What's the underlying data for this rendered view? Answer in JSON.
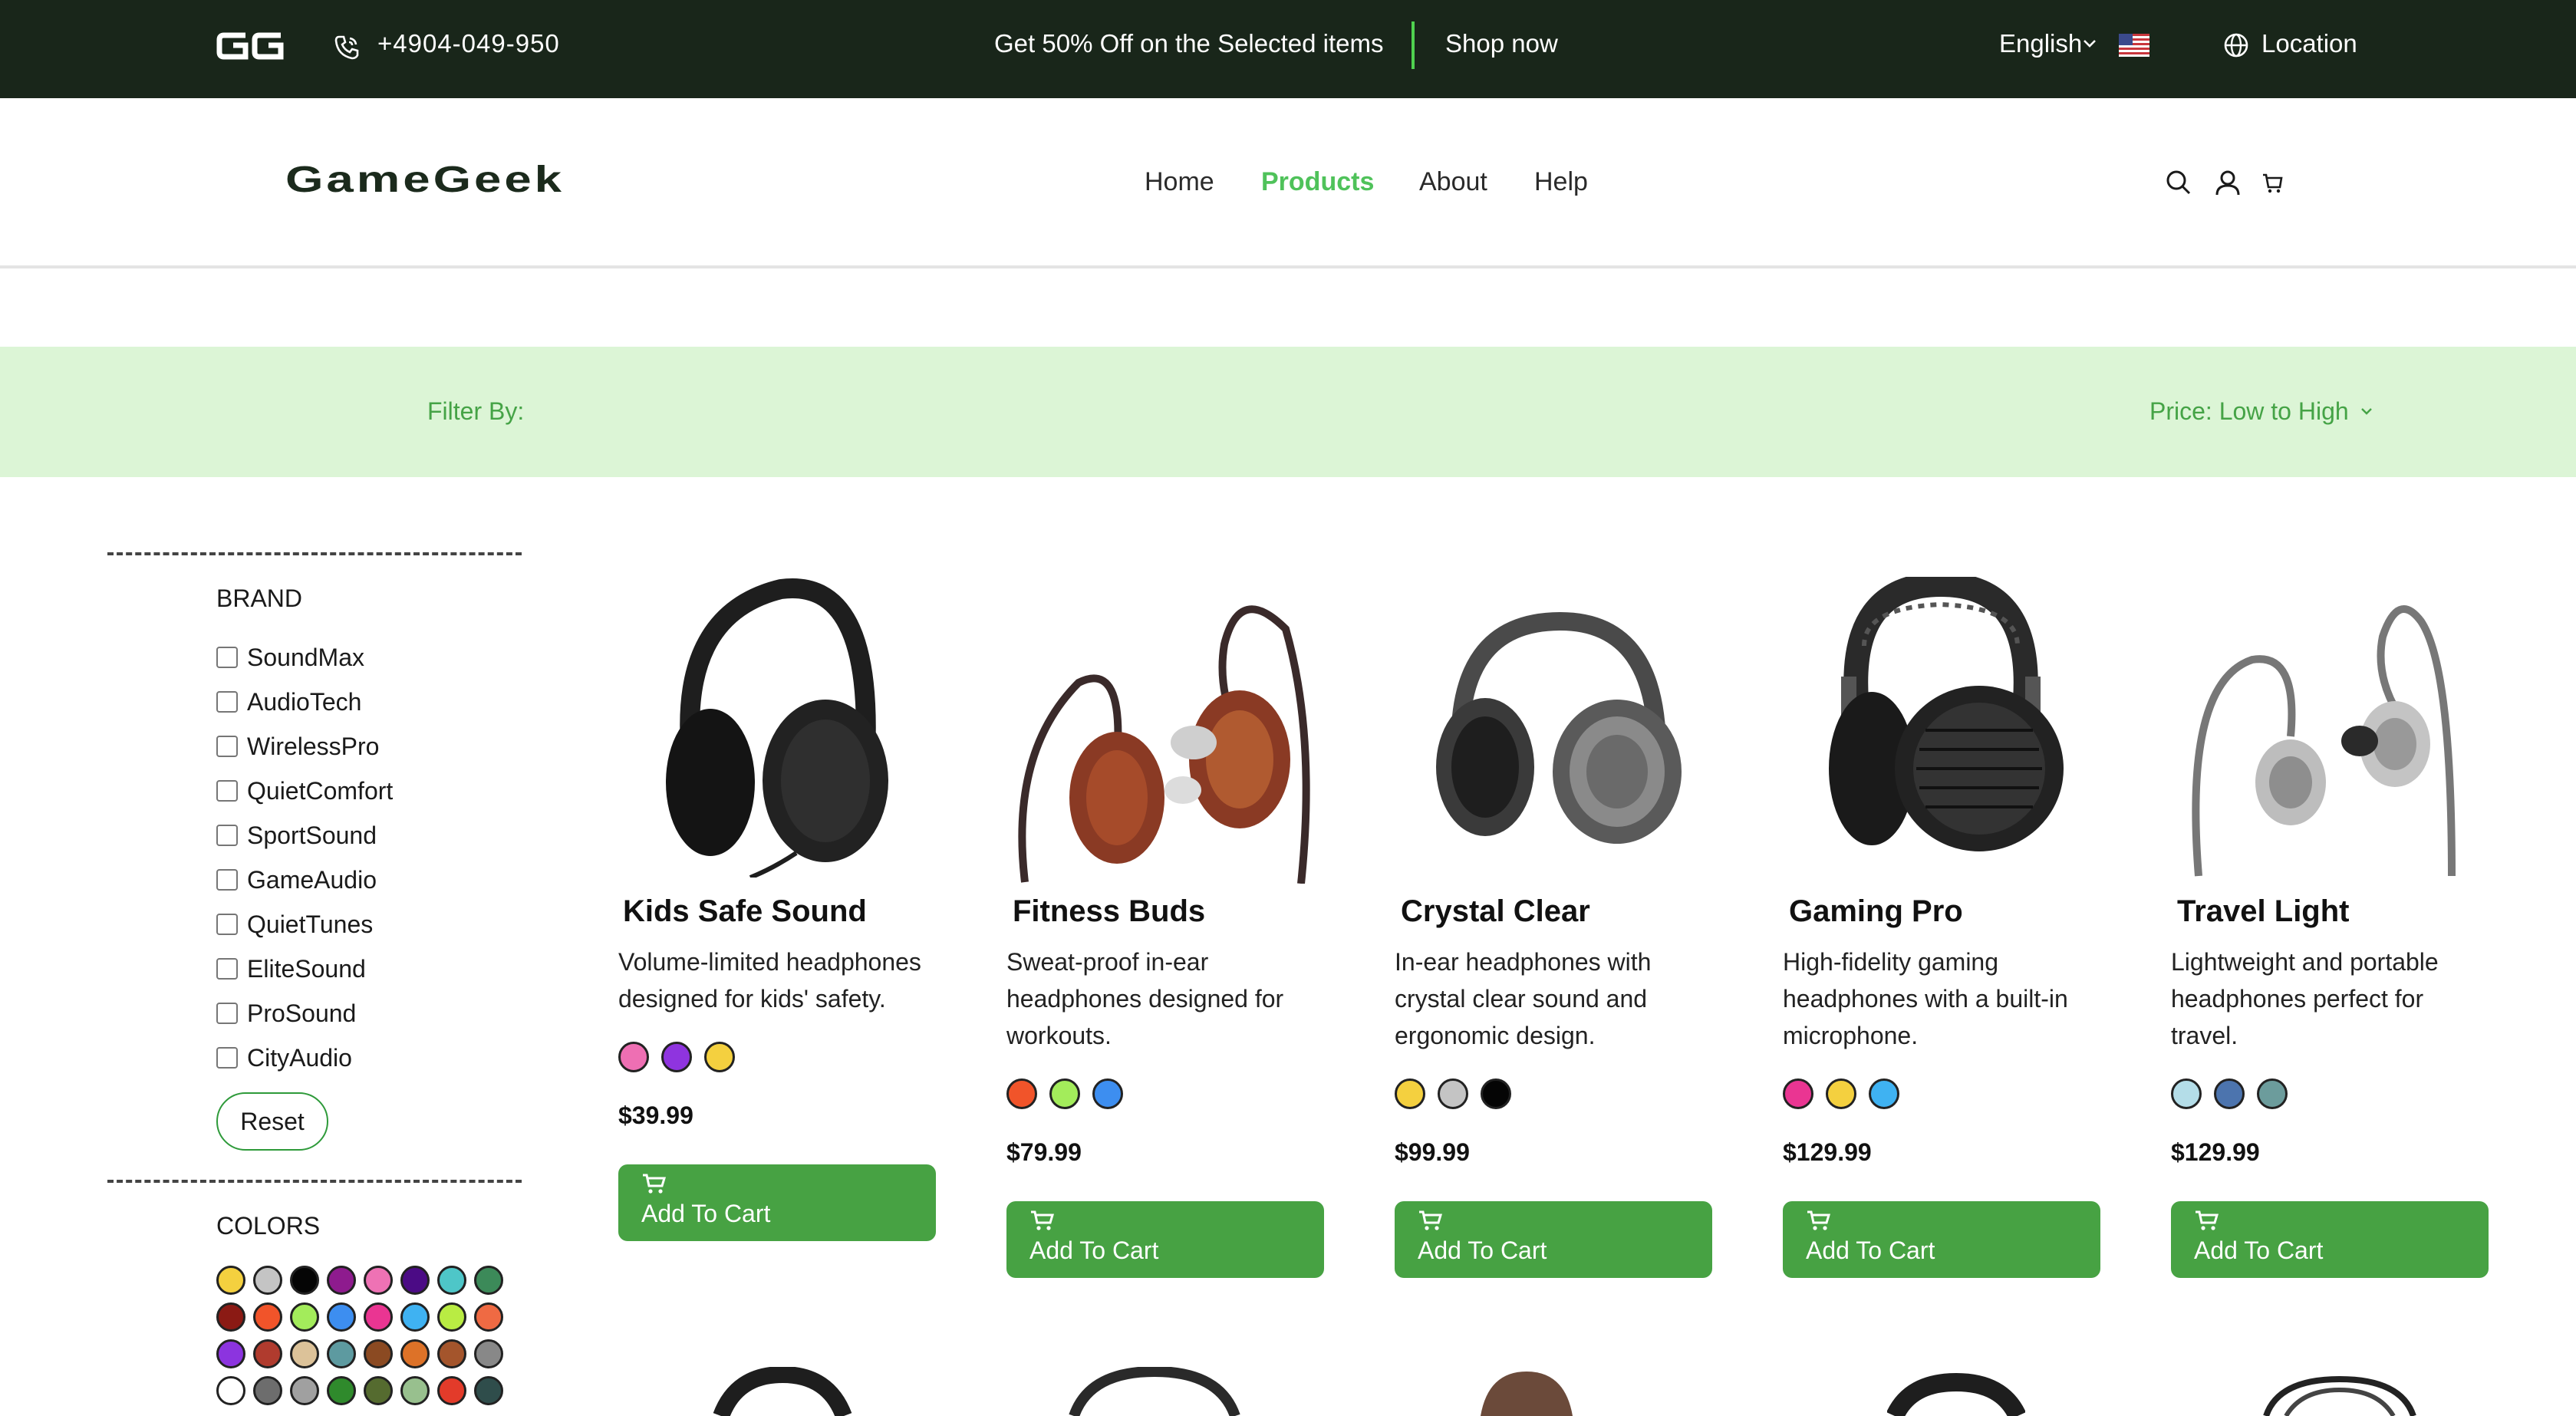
{
  "topbar": {
    "logo_text": "GG",
    "phone": "+4904-049-950",
    "promo": "Get 50% Off on the Selected items",
    "shop_now": "Shop now",
    "language": "English",
    "location": "Location"
  },
  "nav": {
    "brand": "GameGeek",
    "links": [
      {
        "label": "Home",
        "active": false
      },
      {
        "label": "Products",
        "active": true
      },
      {
        "label": "About",
        "active": false
      },
      {
        "label": "Help",
        "active": false
      }
    ],
    "icons": [
      "search-icon",
      "user-icon",
      "cart-icon"
    ]
  },
  "filter": {
    "label": "Filter By:",
    "sort": "Price: Low to High"
  },
  "sidebar": {
    "brand_heading": "BRAND",
    "brands": [
      "SoundMax",
      "AudioTech",
      "WirelessPro",
      "QuietComfort",
      "SportSound",
      "GameAudio",
      "QuietTunes",
      "EliteSound",
      "ProSound",
      "CityAudio"
    ],
    "reset": "Reset",
    "colors_heading": "COLORS",
    "colors": [
      "#f4d03f",
      "#c4c4c4",
      "#050505",
      "#8e1b8e",
      "#ee72b4",
      "#4b0b85",
      "#4ec6c8",
      "#3c8a59",
      "#8b1a14",
      "#f1542a",
      "#a3ec5b",
      "#3d8ef0",
      "#ea3592",
      "#3fb2f2",
      "#b9ec43",
      "#ef6a43",
      "#8c34df",
      "#b03b2e",
      "#dcc299",
      "#5d9aa0",
      "#8b4a22",
      "#dd7228",
      "#a4552c",
      "#888888",
      "#ffffff",
      "#6d6d6d",
      "#a0a0a0",
      "#2f8a2c",
      "#556b2f",
      "#98c08e",
      "#e33b2a",
      "#2f4d4b"
    ]
  },
  "products": [
    {
      "name": "Kids Safe Sound",
      "description": "Volume-limited headphones designed for kids' safety.",
      "colors": [
        "#ee6fb3",
        "#8f34df",
        "#f4d03f"
      ],
      "price": "$39.99",
      "button": "Add To Cart",
      "image": "over-ear-headphones-icon"
    },
    {
      "name": "Fitness Buds",
      "description": "Sweat-proof in-ear headphones designed for workouts.",
      "colors": [
        "#f1542a",
        "#a3ec5b",
        "#3d8ef0"
      ],
      "price": "$79.99",
      "button": "Add To Cart",
      "image": "in-ear-monitors-icon"
    },
    {
      "name": "Crystal Clear",
      "description": "In-ear headphones with crystal clear sound and ergonomic design.",
      "colors": [
        "#f4d03f",
        "#c4c4c4",
        "#050505"
      ],
      "price": "$99.99",
      "button": "Add To Cart",
      "image": "closed-back-headphones-icon"
    },
    {
      "name": "Gaming Pro",
      "description": "High-fidelity gaming headphones with a built-in microphone.",
      "colors": [
        "#ea3592",
        "#f4d03f",
        "#3fb2f2"
      ],
      "price": "$129.99",
      "button": "Add To Cart",
      "image": "planar-headphones-icon"
    },
    {
      "name": "Travel Light",
      "description": "Lightweight and portable headphones perfect for travel.",
      "colors": [
        "#b4dde8",
        "#4c74ae",
        "#6c9c9c"
      ],
      "price": "$129.99",
      "button": "Add To Cart",
      "image": "earbud-icon"
    }
  ]
}
